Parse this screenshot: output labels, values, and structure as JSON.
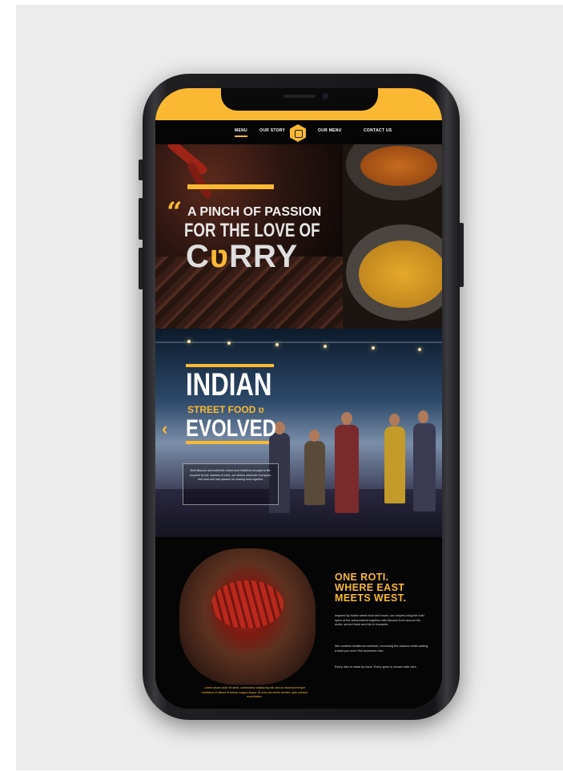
{
  "nav": {
    "items": [
      "MENU",
      "OUR STORY",
      "OUR MENU",
      "CONTACT US"
    ]
  },
  "hero1": {
    "quote_mark": "“",
    "line1": "A PINCH OF PASSION",
    "line2": "FOR THE LOVE OF",
    "line3_pre": "C",
    "line3_accent": "ʋ",
    "line3_post": "RRY"
  },
  "hero2": {
    "title": "INDIAN",
    "subtitle": "STREET FOOD ʋ",
    "evolved": "EVOLVED",
    "arrow": "‹",
    "card_text": "Bold flavours and authentic street-food traditions brought to life. Inspired by the markets of India, our dishes celebrate real spice, real heat and real passion for sharing food together."
  },
  "section3": {
    "heading": [
      "ONE ROTI.",
      "WHERE EAST",
      "MEETS WEST."
    ],
    "para1": "Inspired by Indian street food and travel, our recipes bring the bold spice of the subcontinent together with flavours from around the world, served fresh and full of character.",
    "para2": "We combine traditional methods, honouring the classics while adding a twist you won't find anywhere else.",
    "para3": "Every dish is made by hand. Every spice is chosen with care.",
    "caption": "Lorem ipsum dolor sit amet, consectetur adipiscing elit, sed do eiusmod tempor incididunt ut labore et dolore magna aliqua. Ut enim ad minim veniam, quis nostrud exercitation."
  },
  "colors": {
    "accent": "#fbb933",
    "background": "#070707"
  },
  "icons": [
    "chevron-left-icon",
    "logo-emblem-icon"
  ]
}
